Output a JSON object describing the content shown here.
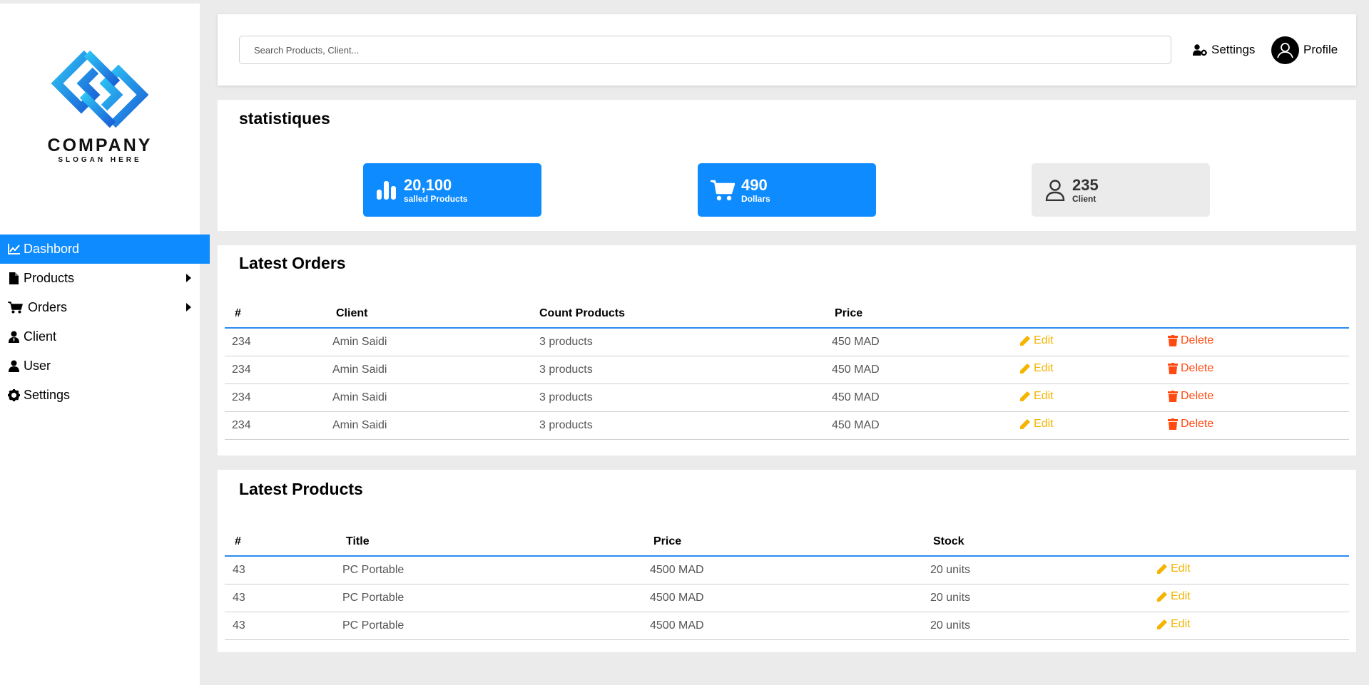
{
  "brand": {
    "name": "COMPANY",
    "slogan": "SLOGAN HERE"
  },
  "nav": {
    "items": [
      {
        "label": "Dashbord",
        "icon": "chart-line-icon",
        "active": true
      },
      {
        "label": "Products",
        "icon": "file-icon",
        "has_submenu": true
      },
      {
        "label": "Orders",
        "icon": "cart-icon",
        "has_submenu": true
      },
      {
        "label": "Client",
        "icon": "user-tie-icon"
      },
      {
        "label": "User",
        "icon": "user-icon"
      },
      {
        "label": "Settings",
        "icon": "gear-icon"
      }
    ]
  },
  "topbar": {
    "search_placeholder": "Search Products, Client...",
    "settings_label": "Settings",
    "profile_label": "Profile"
  },
  "stats": {
    "title": "statistiques",
    "cards": [
      {
        "value": "20,100",
        "label": "salled Products",
        "icon": "bar-chart-icon"
      },
      {
        "value": "490",
        "label": "Dollars",
        "icon": "cart-icon"
      },
      {
        "value": "235",
        "label": "Client",
        "icon": "user-outline-icon"
      }
    ]
  },
  "orders": {
    "title": "Latest Orders",
    "columns": [
      "#",
      "Client",
      "Count Products",
      "Price"
    ],
    "edit_label": "Edit",
    "delete_label": "Delete",
    "rows": [
      {
        "id": "234",
        "client": "Amin Saidi",
        "count": "3 products",
        "price": "450 MAD"
      },
      {
        "id": "234",
        "client": "Amin Saidi",
        "count": "3 products",
        "price": "450 MAD"
      },
      {
        "id": "234",
        "client": "Amin Saidi",
        "count": "3 products",
        "price": "450 MAD"
      },
      {
        "id": "234",
        "client": "Amin Saidi",
        "count": "3 products",
        "price": "450 MAD"
      }
    ]
  },
  "products": {
    "title": "Latest Products",
    "columns": [
      "#",
      "Title",
      "Price",
      "Stock"
    ],
    "edit_label": "Edit",
    "rows": [
      {
        "id": "43",
        "title": "PC Portable",
        "price": "4500 MAD",
        "stock": "20 units"
      },
      {
        "id": "43",
        "title": "PC Portable",
        "price": "4500 MAD",
        "stock": "20 units"
      },
      {
        "id": "43",
        "title": "PC Portable",
        "price": "4500 MAD",
        "stock": "20 units"
      }
    ]
  },
  "colors": {
    "accent": "#0d8bff",
    "edit": "#f4b400",
    "delete": "#ff4b12",
    "background": "#ebebeb"
  }
}
